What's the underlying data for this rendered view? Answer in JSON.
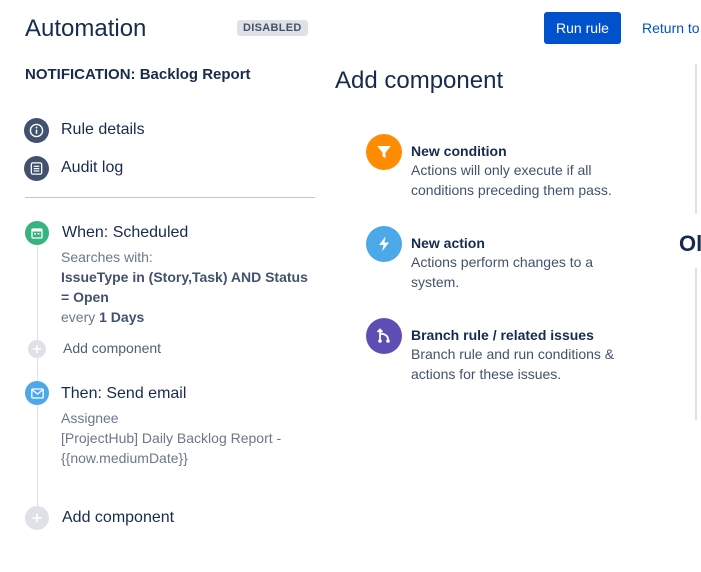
{
  "header": {
    "title": "Automation",
    "status_badge": "DISABLED",
    "run_button": "Run rule",
    "return_link": "Return to"
  },
  "rule_name": "NOTIFICATION: Backlog Report",
  "nav": [
    {
      "label": "Rule details",
      "icon": "info-icon"
    },
    {
      "label": "Audit log",
      "icon": "list-icon"
    }
  ],
  "trigger": {
    "title": "When: Scheduled",
    "line1": "Searches with:",
    "jql": "IssueType in (Story,Task) AND Status = Open",
    "every_prefix": "every",
    "every_value": "1 Days"
  },
  "add_component_small": "Add component",
  "action": {
    "title": "Then: Send email",
    "to": "Assignee",
    "subject": "[ProjectHub] Daily Backlog Report - {{now.mediumDate}}"
  },
  "add_component_large": "Add component",
  "panel": {
    "title": "Add component",
    "options": [
      {
        "title": "New condition",
        "desc": "Actions will only execute if all conditions preceding them pass.",
        "color": "#ff8b00",
        "icon": "filter-icon"
      },
      {
        "title": "New action",
        "desc": "Actions perform changes to a system.",
        "color": "#4ca8e8",
        "icon": "lightning-icon"
      },
      {
        "title": "Branch rule / related issues",
        "desc": "Branch rule and run conditions & actions for these issues.",
        "color": "#5e4db2",
        "icon": "branch-icon"
      }
    ]
  },
  "cut_off_text": "Ol",
  "colors": {
    "primary": "#0052cc",
    "trigger": "#36b37e",
    "action": "#4ca8e8"
  }
}
